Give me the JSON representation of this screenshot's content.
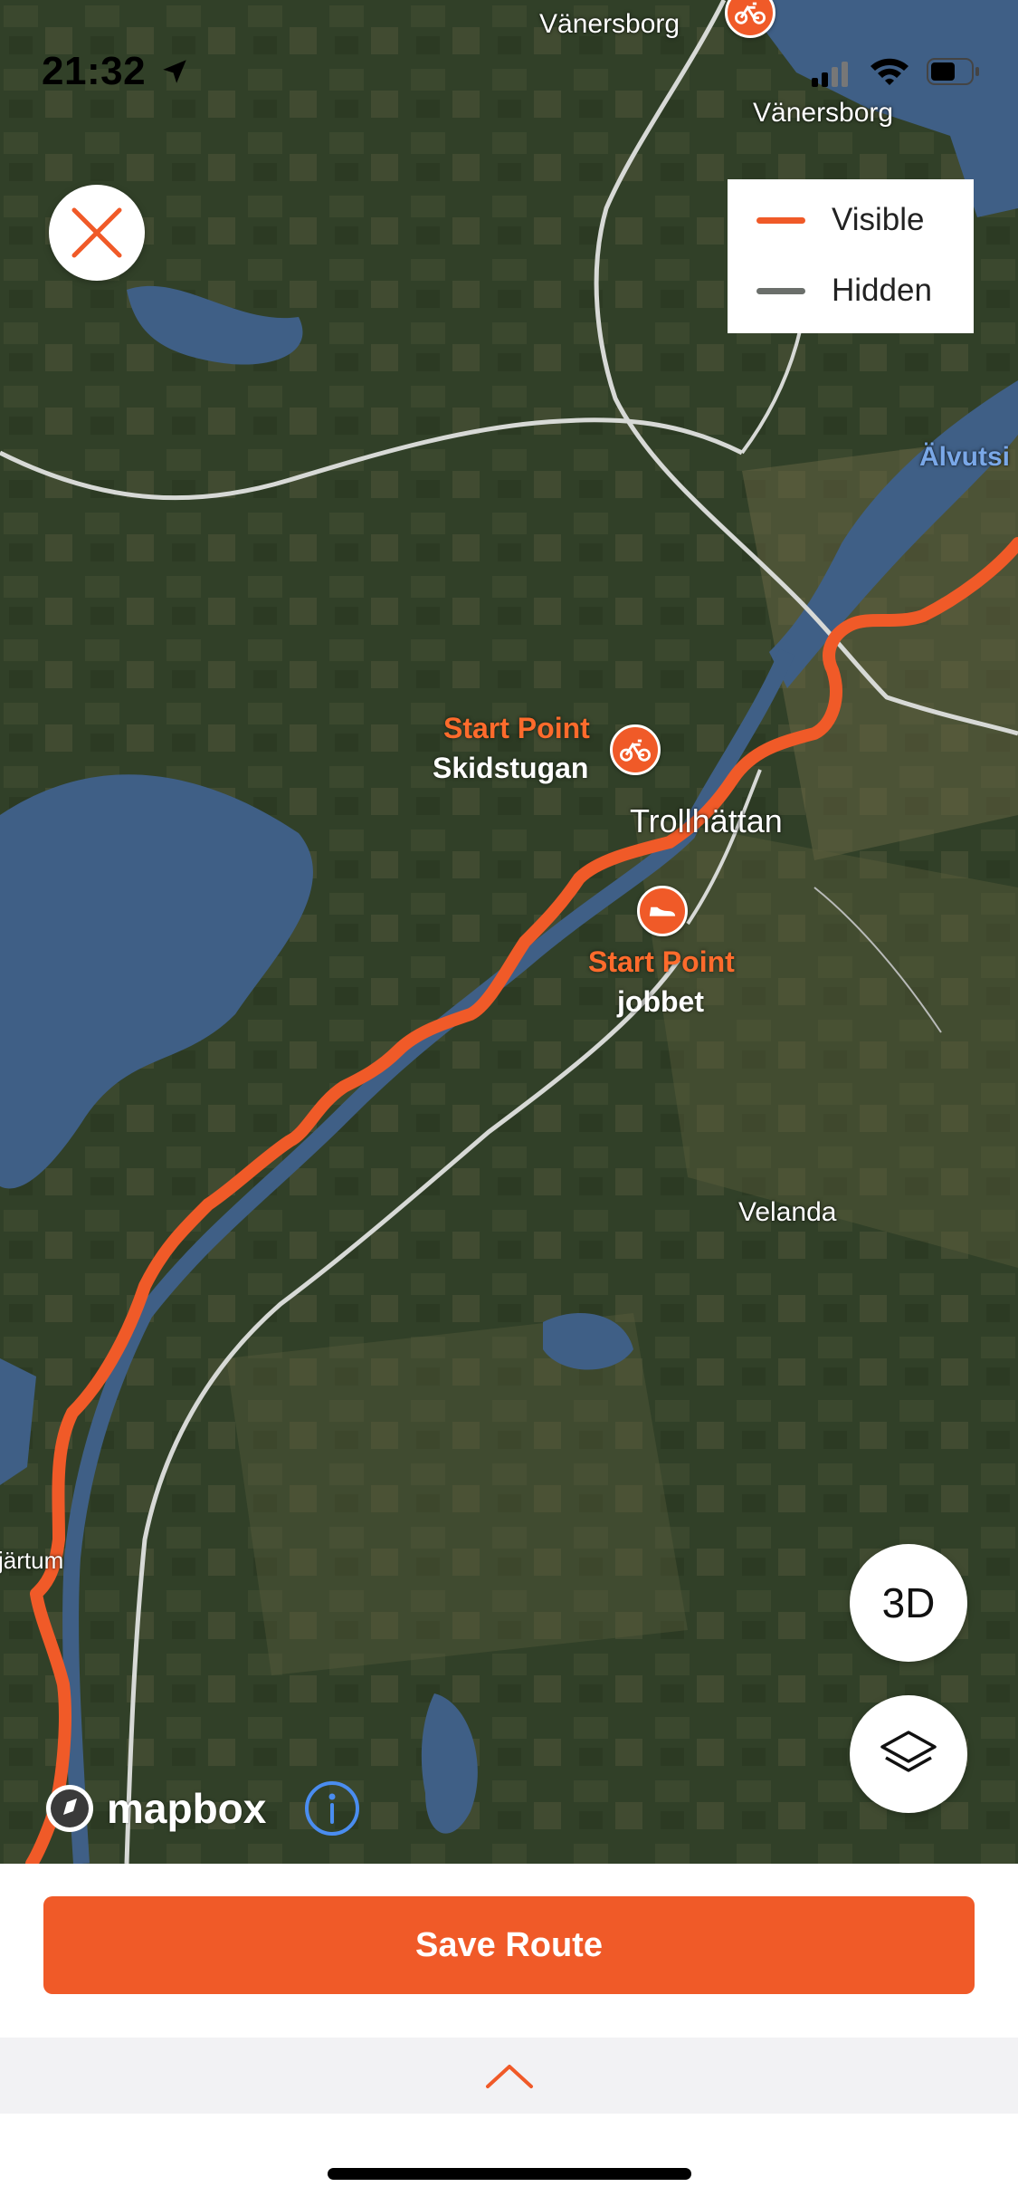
{
  "status_bar": {
    "time": "21:32"
  },
  "legend": {
    "visible_label": "Visible",
    "hidden_label": "Hidden",
    "visible_color": "#f05a28",
    "hidden_color": "#6b6f6b"
  },
  "map": {
    "places": {
      "vanersborg_top": "Vänersborg",
      "vanersborg": "Vänersborg",
      "alvutsi": "Älvutsi",
      "trollhattan": "Trollhättan",
      "velanda": "Velanda",
      "jartum": "järtum"
    },
    "pois": [
      {
        "title": "Start Point",
        "name": "Skidstugan",
        "icon": "bike-icon"
      },
      {
        "title": "Start Point",
        "name": "jobbet",
        "icon": "shoe-icon"
      }
    ],
    "route_color": "#f05a28",
    "attribution": "mapbox"
  },
  "controls": {
    "three_d_label": "3D"
  },
  "bottom": {
    "save_label": "Save Route"
  }
}
